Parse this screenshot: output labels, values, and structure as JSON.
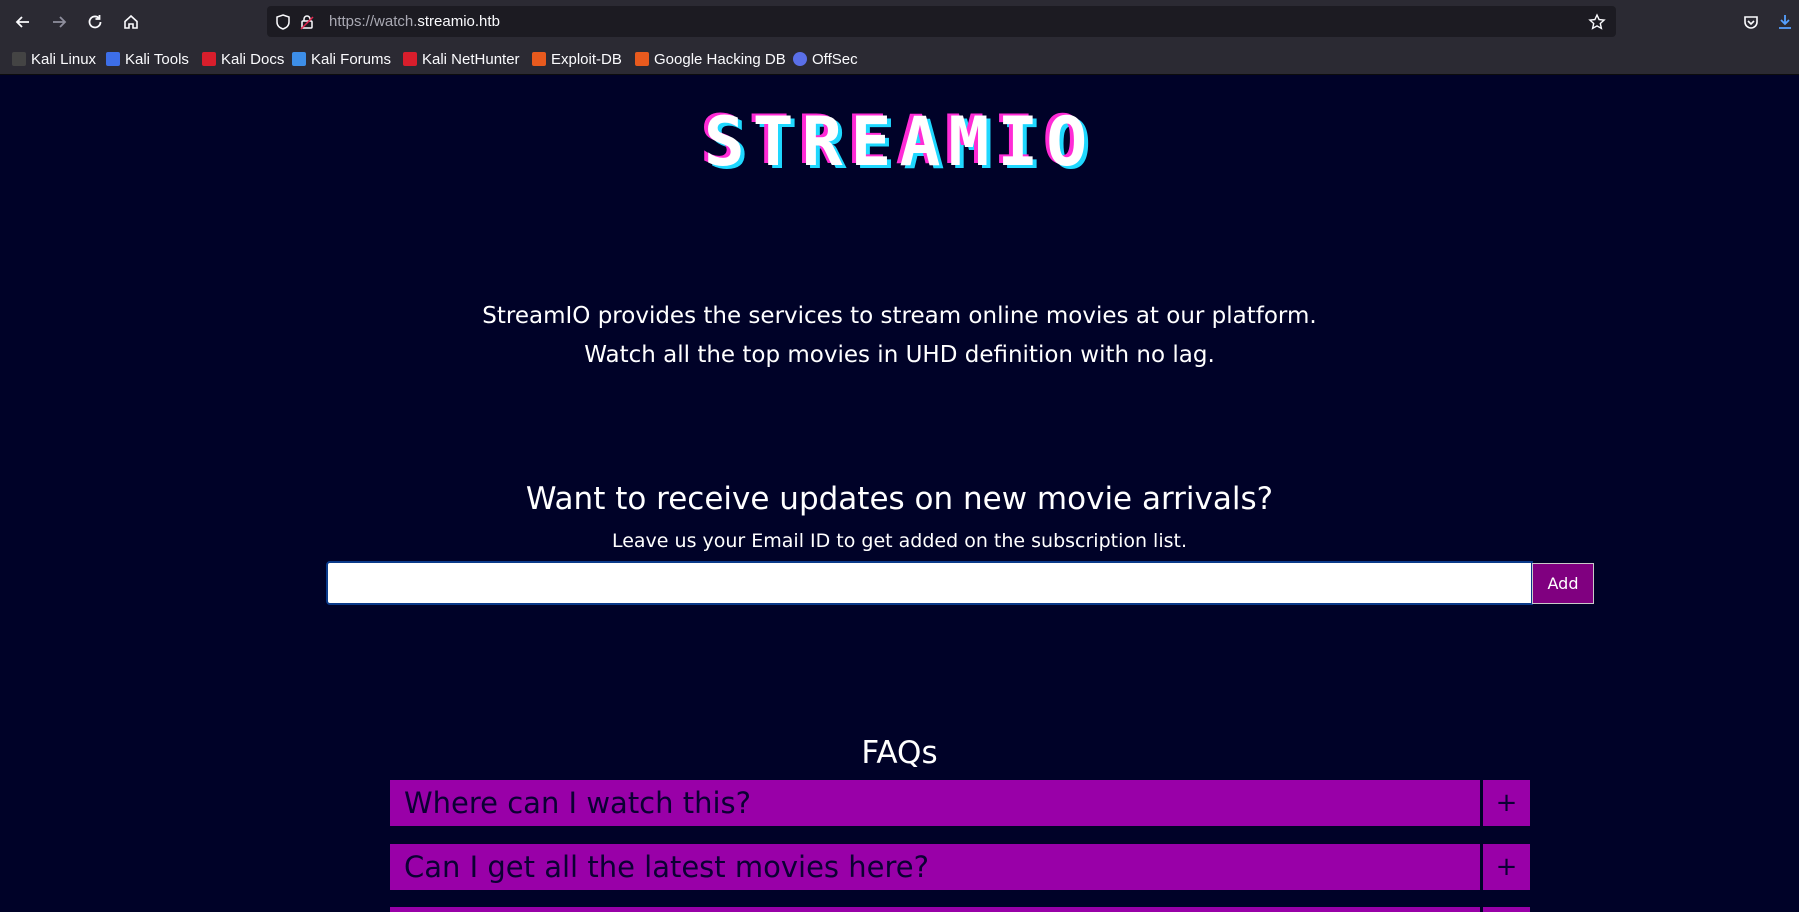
{
  "browser": {
    "url_scheme": "https://watch.",
    "url_host": "streamio.htb",
    "bookmarks": [
      {
        "label": "Kali Linux",
        "color": "#2b2a33"
      },
      {
        "label": "Kali Tools",
        "color": "#3d6ee8"
      },
      {
        "label": "Kali Docs",
        "color": "#d81e2c"
      },
      {
        "label": "Kali Forums",
        "color": "#3d8ee8"
      },
      {
        "label": "Kali NetHunter",
        "color": "#d81e2c"
      },
      {
        "label": "Exploit-DB",
        "color": "#e85a1e"
      },
      {
        "label": "Google Hacking DB",
        "color": "#e85a1e"
      },
      {
        "label": "OffSec",
        "color": "#5a6fe8"
      }
    ]
  },
  "page": {
    "logo": "STREAMIO",
    "tagline_1": "StreamIO provides the services to stream online movies at our platform.",
    "tagline_2": "Watch all the top movies in UHD definition with no lag.",
    "signup": {
      "heading": "Want to receive updates on new movie arrivals?",
      "subheading": "Leave us your Email ID to get added on the subscription list.",
      "email_value": "",
      "add_label": "Add"
    },
    "faq": {
      "title": "FAQs",
      "toggle_symbol": "+",
      "items": [
        {
          "question": "Where can I watch this?"
        },
        {
          "question": "Can I get all the latest movies here?"
        }
      ]
    }
  },
  "colors": {
    "page_background": "#000228",
    "faq_background": "#9900a8",
    "add_button": "#800080",
    "logo_shadow_pink": "#ff2bd6",
    "logo_shadow_cyan": "#1fd8ff"
  }
}
